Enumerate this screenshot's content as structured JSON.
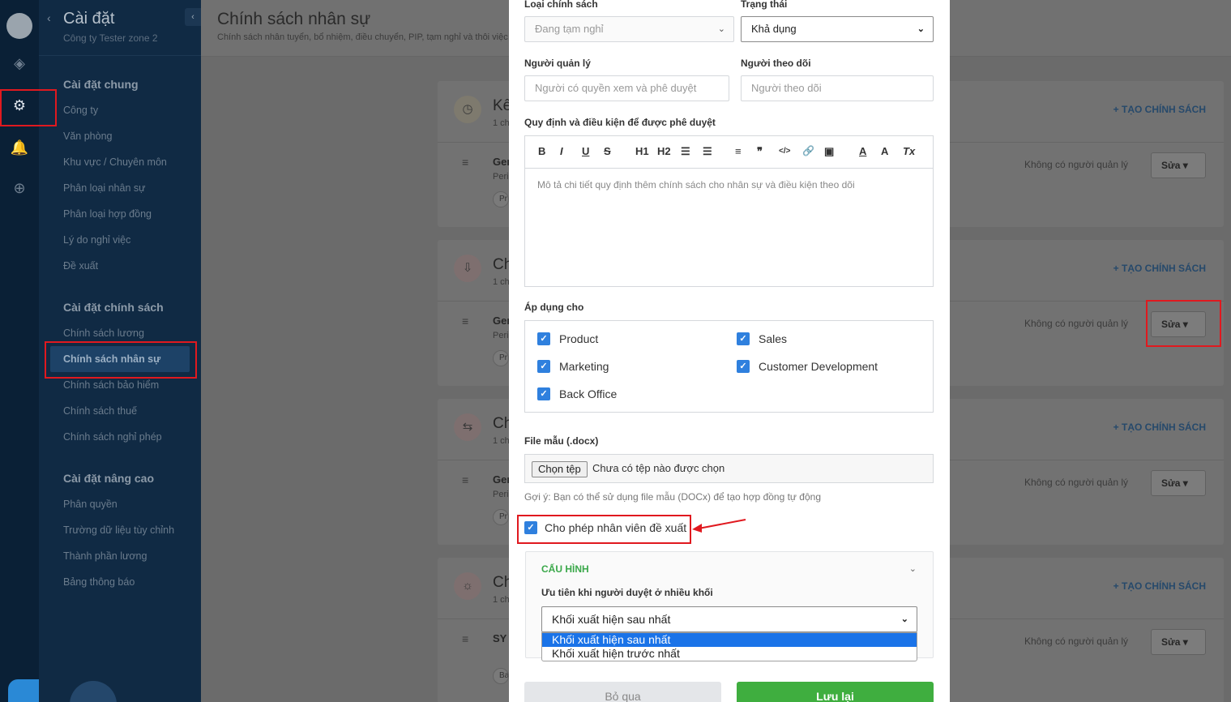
{
  "sidebar": {
    "title": "Cài đặt",
    "company": "Công ty Tester zone 2",
    "sections": [
      {
        "title": "Cài đặt chung",
        "items": [
          "Công ty",
          "Văn phòng",
          "Khu vực / Chuyên môn",
          "Phân loại nhân sự",
          "Phân loại hợp đồng",
          "Lý do nghỉ việc",
          "Đề xuất"
        ]
      },
      {
        "title": "Cài đặt chính sách",
        "items": [
          "Chính sách lương",
          "Chính sách nhân sự",
          "Chính sách bảo hiểm",
          "Chính sách thuế",
          "Chính sách nghỉ phép"
        ]
      },
      {
        "title": "Cài đặt nâng cao",
        "items": [
          "Phân quyền",
          "Trường dữ liệu tùy chỉnh",
          "Thành phần lương",
          "Bảng thông báo"
        ]
      }
    ]
  },
  "main": {
    "title": "Chính sách nhân sự",
    "subtitle": "Chính sách nhân tuyển, bổ nhiệm, điều chuyển, PIP, tạm nghỉ và thôi việc",
    "add_label": "+ TẠO CHÍNH SÁCH",
    "manager_label": "Không có người quản lý",
    "edit_label": "Sửa",
    "cards": [
      {
        "name": "Kế",
        "count": "1 ch",
        "code": "Ger",
        "period": "Peri",
        "chip": "Pr"
      },
      {
        "name": "Ch",
        "count": "1 ch",
        "code": "Ger",
        "period": "Peri",
        "chip": "Pr"
      },
      {
        "name": "Ch",
        "count": "1 ch",
        "code": "Ger",
        "period": "Peri",
        "chip": "Pr"
      },
      {
        "name": "Ch",
        "count": "1 ch",
        "code": "SY",
        "period": "",
        "chip": "Ba"
      }
    ]
  },
  "modal": {
    "type_label": "Loại chính sách",
    "type_value": "Đang tạm nghỉ",
    "status_label": "Trạng thái",
    "status_value": "Khả dụng",
    "manager_label": "Người quản lý",
    "manager_placeholder": "Người có quyền xem và phê duyệt",
    "follower_label": "Người theo dõi",
    "follower_placeholder": "Người theo dõi",
    "rules_label": "Quy định và điều kiện để được phê duyệt",
    "rules_placeholder": "Mô tả chi tiết quy định thêm chính sách cho nhân sự và điều kiện theo dõi",
    "toolbar": [
      "B",
      "I",
      "U",
      "S",
      "H1",
      "H2",
      "☰",
      "☰",
      "≡",
      "❞",
      "</>",
      "🔗",
      "▣",
      "A",
      "A",
      "Tx"
    ],
    "apply_label": "Áp dụng cho",
    "apply_items": [
      "Product",
      "Sales",
      "Marketing",
      "Customer Development",
      "Back Office"
    ],
    "file_label": "File mẫu (.docx)",
    "file_button": "Chọn tệp",
    "file_status": "Chưa có tệp nào được chọn",
    "file_hint": "Gợi ý: Bạn có thể sử dụng file mẫu (DOCx) để tạo hợp đồng tự động",
    "allow_label": "Cho phép nhân viên đề xuất",
    "config_title": "CẤU HÌNH",
    "config_question": "Ưu tiên khi người duyệt ở nhiều khối",
    "config_value": "Khối xuất hiện sau nhất",
    "config_options": [
      "Khối xuất hiện sau nhất",
      "Khối xuất hiện trước nhất"
    ],
    "cancel_label": "Bỏ qua",
    "save_label": "Lưu lại"
  },
  "colors": {
    "accent": "#2f80de",
    "save": "#3fae3f",
    "annotation": "#e0191f",
    "sidebar": "#102a44"
  },
  "icons": [
    "settings-gear-icon",
    "bell-icon",
    "plus-circle-icon",
    "clock-icon",
    "chevron-down-icon",
    "check-icon",
    "menu-lines-icon",
    "caret-down-icon"
  ]
}
